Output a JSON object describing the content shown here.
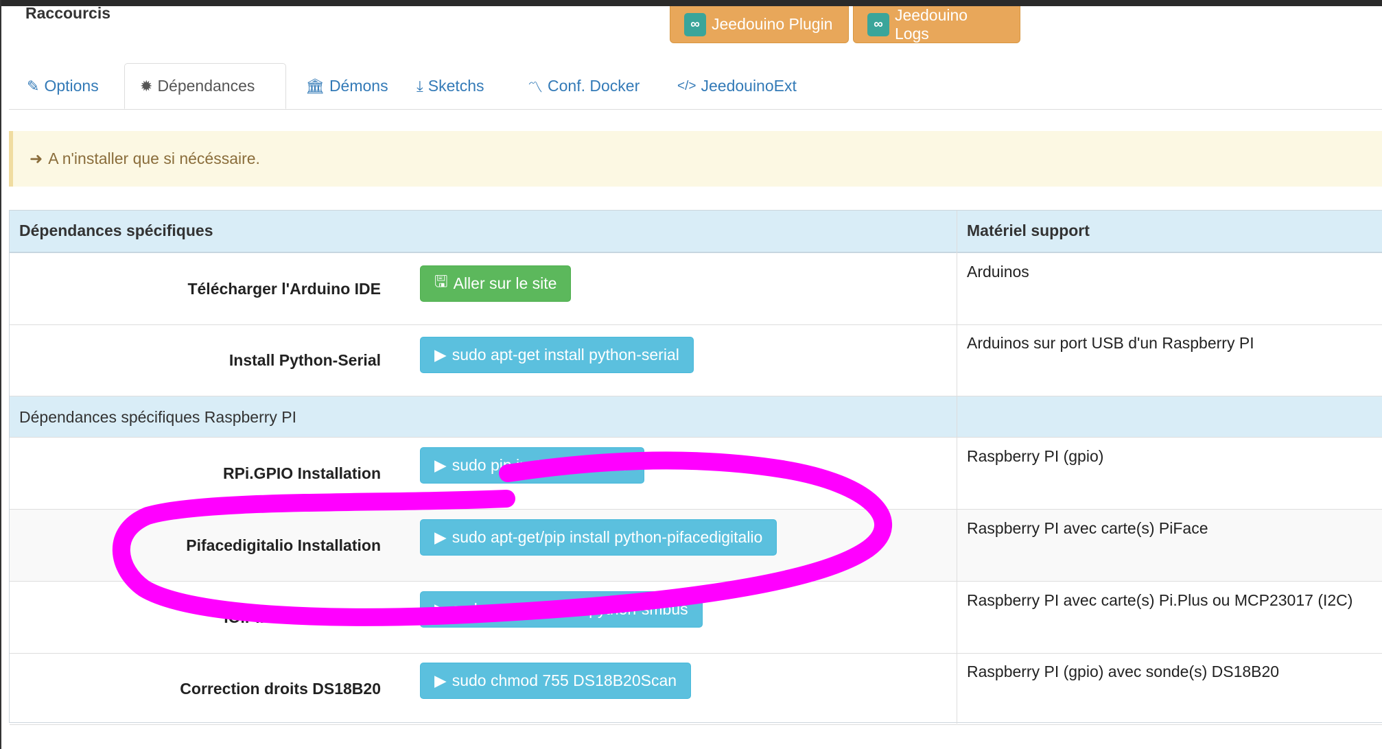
{
  "header": {
    "title": "Raccourcis",
    "plugin_button": "Jeedouino Plugin",
    "logs_button": "Jeedouino Logs"
  },
  "tabs": [
    {
      "label": "Options",
      "icon": "edit-icon",
      "active": false
    },
    {
      "label": "Dépendances",
      "icon": "gear-icon",
      "active": true
    },
    {
      "label": "Démons",
      "icon": "bank-icon",
      "active": false
    },
    {
      "label": "Sketchs",
      "icon": "download-icon",
      "active": false
    },
    {
      "label": "Conf. Docker",
      "icon": "rss-icon",
      "active": false
    },
    {
      "label": "JeedouinoExt",
      "icon": "code-icon",
      "active": false
    }
  ],
  "alert": {
    "text": "A n'installer que si nécéssaire.",
    "icon": "arrow-right-icon"
  },
  "table": {
    "col1_header": "Dépendances spécifiques",
    "col2_header": "Matériel support",
    "rows": [
      {
        "label": "Télécharger l'Arduino IDE",
        "button": "Aller sur le site",
        "icon": "save-icon",
        "support": "Arduinos"
      },
      {
        "label": "Install Python-Serial",
        "button": "sudo apt-get install python-serial",
        "icon": "play-icon",
        "support": "Arduinos sur port USB d'un Raspberry PI"
      }
    ],
    "section_title": "Dépendances spécifiques Raspberry PI",
    "rpi_rows": [
      {
        "label": "RPi.GPIO Installation",
        "button": "sudo pip install RPi.GPIO",
        "icon": "play-icon",
        "support": "Raspberry PI (gpio)"
      },
      {
        "label": "Pifacedigitalio Installation",
        "button": "sudo apt-get/pip install python-pifacedigitalio",
        "icon": "play-icon",
        "support": "Raspberry PI avec carte(s) PiFace"
      },
      {
        "label": "IO.PiPlus Installation",
        "button": "sudo apt-get install python-smbus",
        "icon": "play-icon",
        "support": "Raspberry PI avec carte(s) Pi.Plus ou MCP23017 (I2C)"
      },
      {
        "label": "Correction droits DS18B20",
        "button": "sudo chmod 755 DS18B20Scan",
        "icon": "play-icon",
        "support": "Raspberry PI (gpio) avec sonde(s) DS18B20"
      }
    ]
  },
  "colors": {
    "highlight": "#ff00ff",
    "warning_bg": "#fcf8e3",
    "info_bg": "#d9edf7",
    "btn_info": "#5bc0de",
    "btn_success": "#5cb85c",
    "btn_warning": "#e8a75a"
  }
}
